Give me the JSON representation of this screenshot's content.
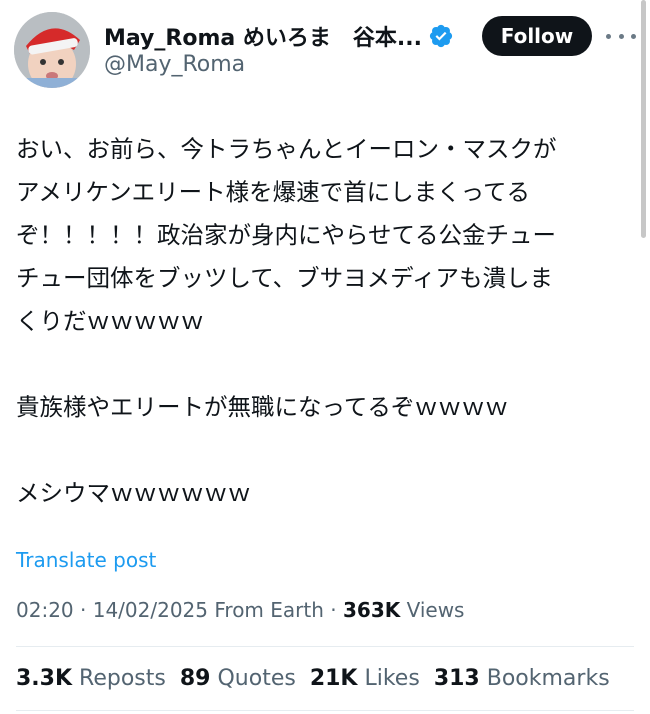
{
  "author": {
    "name": "May_Roma めいろま　谷本...",
    "handle": "@May_Roma",
    "follow_label": "Follow"
  },
  "post": {
    "lines": [
      "おい、お前ら、今トラちゃんとイーロン・マスクが",
      "アメリケンエリート様を爆速で首にしまくってる",
      "ぞ！！！！！政治家が身内にやらせてる公金チュー",
      "チュー団体をブッツして、ブサヨメディアも潰しま",
      "くりだｗｗｗｗｗ",
      "",
      "貴族様やエリートが無職になってるぞｗｗｗｗ",
      "",
      "メシウマｗｗｗｗｗｗ"
    ],
    "translate_label": "Translate post",
    "time": "02:20",
    "date": "14/02/2025",
    "source": "From Earth",
    "views_count": "363K",
    "views_label": "Views"
  },
  "stats": {
    "reposts_count": "3.3K",
    "reposts_label": "Reposts",
    "quotes_count": "89",
    "quotes_label": "Quotes",
    "likes_count": "21K",
    "likes_label": "Likes",
    "bookmarks_count": "313",
    "bookmarks_label": "Bookmarks"
  },
  "colors": {
    "link": "#1d9bf0",
    "verified": "#1d9bf0",
    "follow_bg": "#0f1419",
    "secondary_text": "#536471"
  },
  "icons": {
    "verified": "verified-badge-icon",
    "more": "more-options-icon"
  }
}
